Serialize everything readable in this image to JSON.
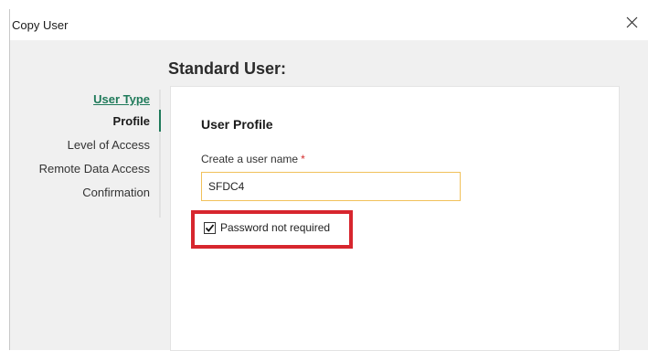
{
  "window": {
    "title": "Copy User",
    "close_icon": "close-icon"
  },
  "page": {
    "heading": "Standard User:"
  },
  "nav": {
    "items": [
      {
        "label": "User Type",
        "state": "completed"
      },
      {
        "label": "Profile",
        "state": "active"
      },
      {
        "label": "Level of Access",
        "state": "pending"
      },
      {
        "label": "Remote Data Access",
        "state": "pending"
      },
      {
        "label": "Confirmation",
        "state": "pending"
      }
    ],
    "accent_color": "#1f7a5a"
  },
  "profile": {
    "section_title": "User Profile",
    "username_label": "Create a user name",
    "required_marker": "*",
    "username_value": "SFDC4",
    "password_checkbox": {
      "label": "Password not required",
      "checked": true
    },
    "highlight_color": "#d7262e"
  }
}
